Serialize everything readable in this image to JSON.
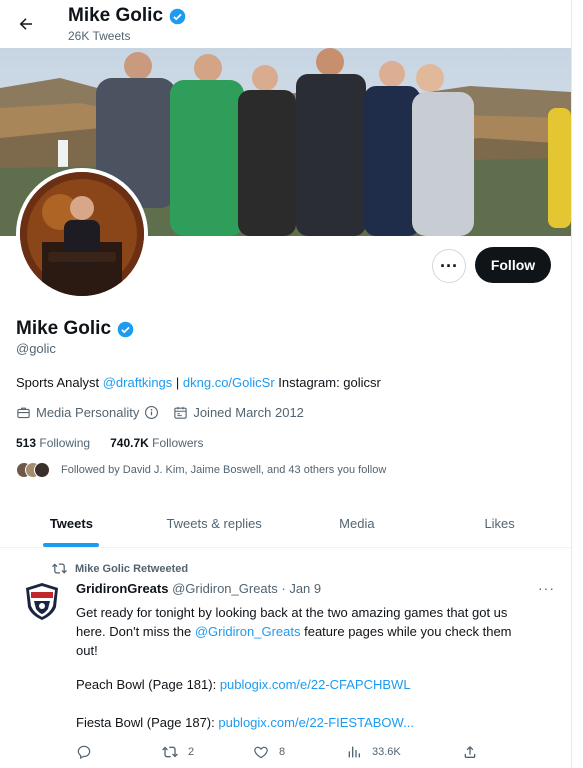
{
  "header": {
    "title": "Mike Golic",
    "tweet_count": "26K Tweets"
  },
  "profile": {
    "name": "Mike Golic",
    "handle": "@golic",
    "follow_label": "Follow",
    "bio": {
      "prefix": "Sports Analyst ",
      "mention": "@draftkings",
      "sep": " | ",
      "link": "dkng.co/GolicSr",
      "suffix": " Instagram: golicsr"
    },
    "category": "Media Personality",
    "joined": "Joined March 2012",
    "following_count": "513",
    "following_label": "Following",
    "followers_count": "740.7K",
    "followers_label": "Followers",
    "followed_by": "Followed by David J. Kim, Jaime Boswell, and 43 others you follow"
  },
  "tabs": [
    "Tweets",
    "Tweets & replies",
    "Media",
    "Likes"
  ],
  "tweet": {
    "retweet_label": "Mike Golic Retweeted",
    "author": "GridironGreats",
    "handle_date": "@Gridiron_Greats · Jan 9",
    "line1": "Get ready for tonight by looking back at the two amazing games that got us",
    "line2_pre": "here. Don't miss the ",
    "line2_mention": "@Gridiron_Greats",
    "line2_post": " feature pages while you check them",
    "line3": "out!",
    "peach_label": "Peach Bowl (Page 181): ",
    "peach_link": "publogix.com/e/22-CFAPCHBWL",
    "fiesta_label": "Fiesta Bowl (Page 187): ",
    "fiesta_link": "publogix.com/e/22-FIESTABOW...",
    "retweets": "2",
    "likes": "8",
    "views": "33.6K"
  },
  "colors": {
    "accent": "#1d9bf0",
    "text": "#0f1419",
    "muted": "#536471"
  },
  "icons": [
    "back-arrow-icon",
    "verified-badge-icon",
    "more-icon",
    "briefcase-icon",
    "info-icon",
    "calendar-icon",
    "retweet-icon",
    "reply-icon",
    "like-icon",
    "views-icon",
    "share-icon"
  ]
}
